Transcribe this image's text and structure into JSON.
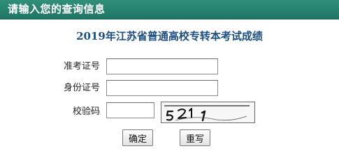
{
  "header": {
    "title": "请输入您的查询信息"
  },
  "page": {
    "title": "2019年江苏省普通高校专转本考试成绩"
  },
  "form": {
    "exam_id_label": "准考证号",
    "exam_id_value": "",
    "id_card_label": "身份证号",
    "id_card_value": "",
    "captcha_label": "校验码",
    "captcha_value": "",
    "captcha_image_text": "5 2 1 1"
  },
  "buttons": {
    "confirm_label": "确定",
    "reset_label": "重写"
  },
  "colors": {
    "header_bg": "#2f8f7a",
    "header_text": "#ffffff",
    "title_text": "#1d4e80"
  }
}
